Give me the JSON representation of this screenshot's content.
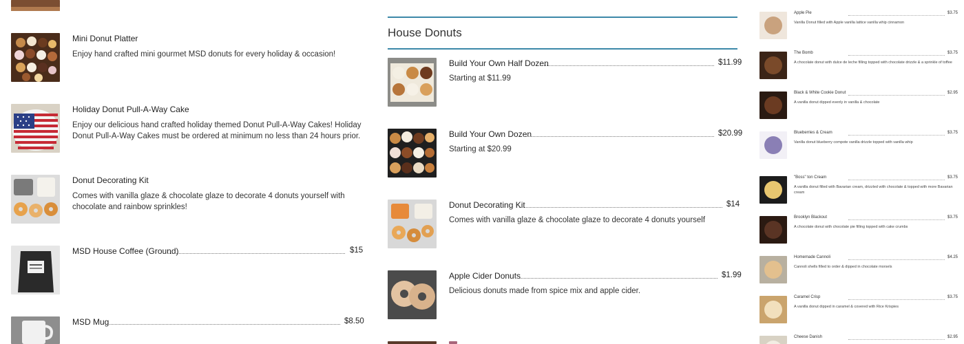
{
  "colors": {
    "accent": "#3b88a8",
    "text": "#333333"
  },
  "left_column": {
    "items": [
      {
        "name": "Mini Donut Platter",
        "description": "Enjoy hand crafted mini gourmet MSD donuts for every holiday & occasion!",
        "price": ""
      },
      {
        "name": "Holiday Donut Pull-A-Way Cake",
        "description": "Enjoy our delicious hand crafted holiday themed Donut Pull-A-Way Cakes! Holiday Donut Pull-A-Way Cakes must be ordered at minimum no less than 24 hours prior.",
        "price": ""
      },
      {
        "name": "Donut Decorating Kit",
        "description": "Comes with vanilla glaze & chocolate glaze to decorate 4 donuts yourself with chocolate and rainbow sprinkles!",
        "price": ""
      },
      {
        "name": "MSD House Coffee (Ground)",
        "description": "",
        "price": "$15"
      },
      {
        "name": "MSD Mug",
        "description": "",
        "price": "$8.50"
      }
    ]
  },
  "middle_column": {
    "section_title": "House Donuts",
    "items": [
      {
        "name": "Build Your Own Half Dozen",
        "description": "Starting at $11.99",
        "price": "$11.99"
      },
      {
        "name": "Build Your Own Dozen",
        "description": "Starting at $20.99",
        "price": "$20.99"
      },
      {
        "name": "Donut Decorating Kit",
        "description": "Comes with vanilla glaze & chocolate glaze to decorate 4 donuts yourself",
        "price": "$14"
      },
      {
        "name": "Apple Cider Donuts",
        "description": "Delicious donuts made from spice mix and apple cider.",
        "price": "$1.99"
      }
    ]
  },
  "right_column": {
    "items": [
      {
        "name": "Apple Pie",
        "description": "Vanilla Donut filled with Apple vanilla lattice vanilla whip cinnamon",
        "price": "$3.75"
      },
      {
        "name": "The Bomb",
        "description": "A chocolate donut with dulce de leche filling topped with chocolate drizzle & a sprinkle of toffee",
        "price": "$3.75"
      },
      {
        "name": "Black & White Cookie Donut",
        "description": "A vanilla donut dipped evenly in vanilla & chocolate",
        "price": "$2.95"
      },
      {
        "name": "Blueberries & Cream",
        "description": "Vanilla donut blueberry compote vanilla drizzle topped with vanilla whip",
        "price": "$3.75"
      },
      {
        "name": "\"Boss\" ton Cream",
        "description": "A vanilla donut filled with Bavarian cream, drizzled with chocolate & topped with more Bavarian cream",
        "price": "$3.75"
      },
      {
        "name": "Brooklyn Blackout",
        "description": "A chocolate donut with chocolate pie filling topped with cake crumbs",
        "price": "$3.75"
      },
      {
        "name": "Homemade Cannoli",
        "description": "Cannoli shells filled to order & dipped in chocolate morsels",
        "price": "$4.25"
      },
      {
        "name": "Caramel Crisp",
        "description": "A vanilla donut dipped in caramel & covered with Rice Krispies",
        "price": "$3.75"
      },
      {
        "name": "Cheese Danish",
        "description": "",
        "price": "$2.95"
      }
    ]
  }
}
